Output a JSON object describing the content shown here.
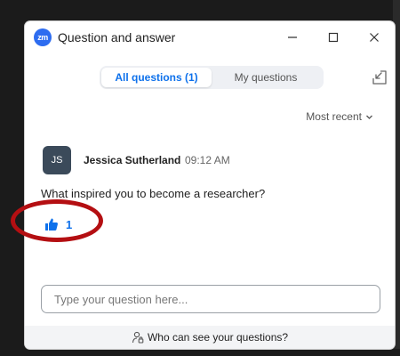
{
  "window": {
    "title": "Question and answer",
    "app_logo_text": "zm",
    "controls": {
      "minimize": "minimize-icon",
      "maximize": "maximize-icon",
      "close": "close-icon"
    }
  },
  "tabs": {
    "all_label": "All questions (1)",
    "mine_label": "My questions",
    "selected": "all"
  },
  "sort": {
    "label": "Most recent"
  },
  "question": {
    "avatar_initials": "JS",
    "asker_name": "Jessica Sutherland",
    "time": "09:12 AM",
    "text": "What inspired you to become a researcher?",
    "likes": "1",
    "like_icon": "thumbs-up-icon"
  },
  "composer": {
    "placeholder": "Type your question here...",
    "value": ""
  },
  "footer": {
    "link_label": "Who can see your questions?",
    "icon": "person-lock-icon"
  },
  "colors": {
    "accent": "#0e71eb",
    "highlight": "#b40f12",
    "avatar_bg": "#3b4a5a",
    "logo_bg": "#2d6cf0"
  }
}
